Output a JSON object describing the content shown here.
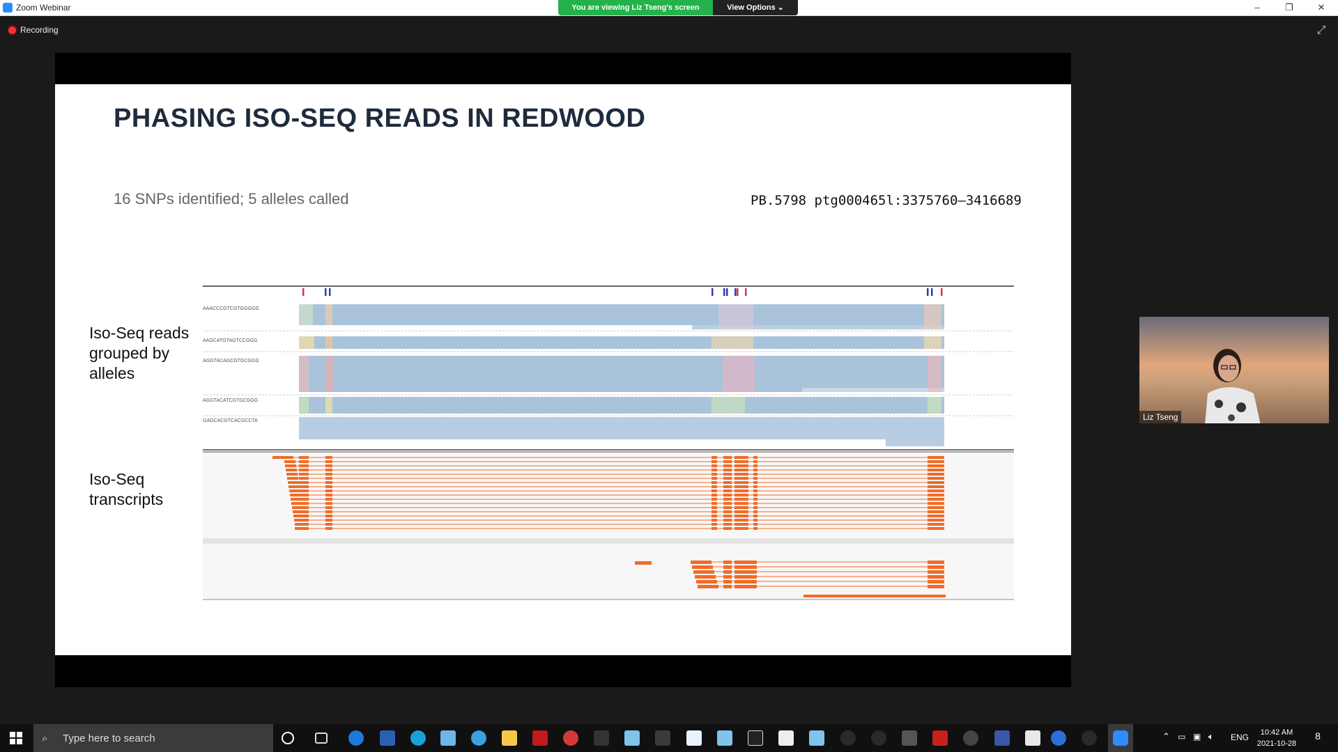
{
  "window": {
    "title": "Zoom Webinar",
    "controls": [
      "–",
      "❐",
      "✕"
    ]
  },
  "banner": {
    "viewing": "You are viewing Liz Tseng's screen",
    "view_options": "View Options ⌄"
  },
  "recording": {
    "label": "Recording"
  },
  "slide": {
    "title": "PHASING ISO-SEQ READS IN REDWOOD",
    "subtitle": "16 SNPs identified; 5 alleles called",
    "locus": "PB.5798 ptg000465l:3375760–3416689",
    "label_reads": "Iso-Seq reads grouped by alleles",
    "label_transcripts": "Iso-Seq transcripts",
    "alleles": [
      "AAACCCGTCGTGGGGG",
      "AAGCATGTAGTCCGGG",
      "AGGTACAGCGTGCGGG",
      "AGGTACATCGTGCGGG",
      "GAGCACGTCACGCCTA"
    ]
  },
  "video": {
    "participant": "Liz Tseng"
  },
  "taskbar": {
    "search_placeholder": "Type here to search",
    "language": "ENG",
    "time": "10:42 AM",
    "date": "2021-10-28",
    "notification_count": "8"
  },
  "colors": {
    "banner_green": "#23b24b",
    "read_blue": "#a9c4da",
    "transcript_orange": "#f26b27",
    "snp_red": "#d9334a",
    "snp_blue": "#2b3bb6"
  }
}
